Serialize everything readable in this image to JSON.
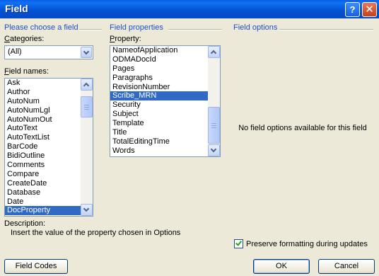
{
  "window": {
    "title": "Field",
    "help_glyph": "?",
    "close_glyph": "✕"
  },
  "left": {
    "section_title": "Please choose a field",
    "categories_label": "Categories:",
    "categories_value": "(All)",
    "field_names_label": "Field names:",
    "field_names": [
      "Ask",
      "Author",
      "AutoNum",
      "AutoNumLgl",
      "AutoNumOut",
      "AutoText",
      "AutoTextList",
      "BarCode",
      "BidiOutline",
      "Comments",
      "Compare",
      "CreateDate",
      "Database",
      "Date",
      "DocProperty"
    ],
    "selected_field": "DocProperty",
    "description_label": "Description:",
    "description_text": "Insert the value of the property chosen in Options"
  },
  "middle": {
    "section_title": "Field properties",
    "property_label": "Property:",
    "properties": [
      "NameofApplication",
      "ODMADocId",
      "Pages",
      "Paragraphs",
      "RevisionNumber",
      "Scribe_MRN",
      "Security",
      "Subject",
      "Template",
      "Title",
      "TotalEditingTime",
      "Words"
    ],
    "selected_property": "Scribe_MRN"
  },
  "right": {
    "section_title": "Field options",
    "empty_text": "No field options available for this field",
    "preserve_label": "Preserve formatting during updates",
    "preserve_checked": true
  },
  "buttons": {
    "field_codes": "Field Codes",
    "ok": "OK",
    "cancel": "Cancel"
  },
  "colors": {
    "title_bar": "#0453d5",
    "section_title": "#2050c0",
    "selection": "#316ac5",
    "dialog_bg": "#ece9d8"
  }
}
